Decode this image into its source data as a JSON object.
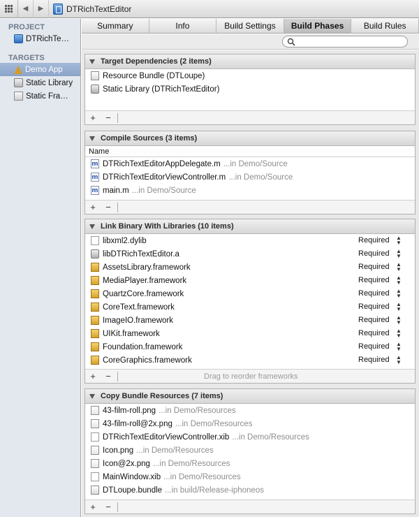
{
  "jumpbar": {
    "title": "DTRichTextEditor"
  },
  "sidebar": {
    "project_header": "PROJECT",
    "project_item": "DTRichTe…",
    "targets_header": "TARGETS",
    "targets": [
      "Demo App",
      "Static Library",
      "Static Fra…"
    ]
  },
  "tabs": [
    "Summary",
    "Info",
    "Build Settings",
    "Build Phases",
    "Build Rules"
  ],
  "active_tab": "Build Phases",
  "phases": {
    "dependencies": {
      "title": "Target Dependencies (2 items)",
      "items": [
        "Resource Bundle (DTLoupe)",
        "Static Library (DTRichTextEditor)"
      ]
    },
    "compile": {
      "title": "Compile Sources (3 items)",
      "column": "Name",
      "items": [
        {
          "name": "DTRichTextEditorAppDelegate.m",
          "loc": "...in Demo/Source"
        },
        {
          "name": "DTRichTextEditorViewController.m",
          "loc": "...in Demo/Source"
        },
        {
          "name": "main.m",
          "loc": "...in Demo/Source"
        }
      ]
    },
    "link": {
      "title": "Link Binary With Libraries (10 items)",
      "status": "Required",
      "hint": "Drag to reorder frameworks",
      "items": [
        "libxml2.dylib",
        "libDTRichTextEditor.a",
        "AssetsLibrary.framework",
        "MediaPlayer.framework",
        "QuartzCore.framework",
        "CoreText.framework",
        "ImageIO.framework",
        "UIKit.framework",
        "Foundation.framework",
        "CoreGraphics.framework"
      ]
    },
    "copy": {
      "title": "Copy Bundle Resources (7 items)",
      "items": [
        {
          "name": "43-film-roll.png",
          "loc": "...in Demo/Resources"
        },
        {
          "name": "43-film-roll@2x.png",
          "loc": "...in Demo/Resources"
        },
        {
          "name": "DTRichTextEditorViewController.xib",
          "loc": "...in Demo/Resources"
        },
        {
          "name": "Icon.png",
          "loc": "...in Demo/Resources"
        },
        {
          "name": "Icon@2x.png",
          "loc": "...in Demo/Resources"
        },
        {
          "name": "MainWindow.xib",
          "loc": "...in Demo/Resources"
        },
        {
          "name": "DTLoupe.bundle",
          "loc": "...in build/Release-iphoneos"
        }
      ]
    }
  },
  "footer": {
    "add": "+",
    "remove": "−"
  }
}
